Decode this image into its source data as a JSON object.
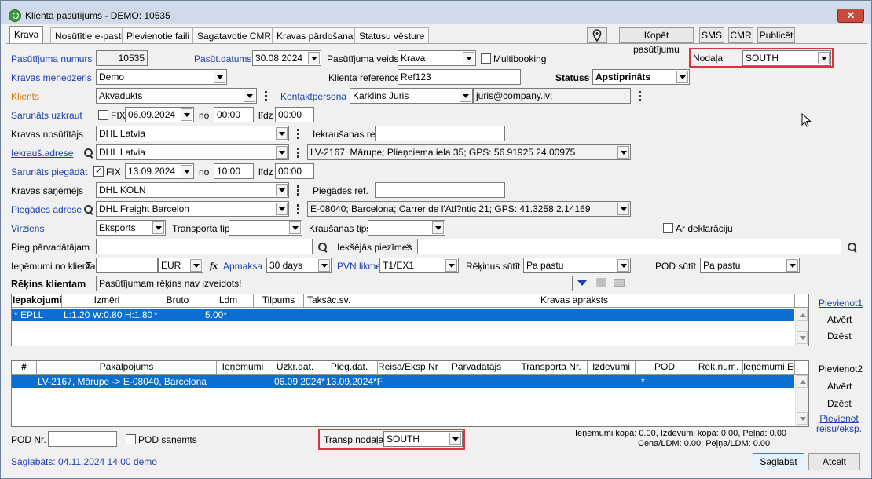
{
  "window": {
    "title": "Klienta pasūtījums - DEMO: 10535",
    "close": "✕"
  },
  "tabs": [
    {
      "label": "Krava"
    },
    {
      "label": "Nosūtītie e-pasti"
    },
    {
      "label": "Pievienotie faili"
    },
    {
      "label": "Sagatavotie CMR"
    },
    {
      "label": "Kravas pārdošana"
    },
    {
      "label": "Statusu vēsture"
    }
  ],
  "toolbar": {
    "copy": "Kopēt pasūtījumu",
    "sms": "SMS",
    "cmr": "CMR",
    "publish": "Publicēt"
  },
  "form": {
    "order_no_label": "Pasūtījuma numurs",
    "order_no": "10535",
    "order_date_label": "Pasūt.datums",
    "order_date": "30.08.2024",
    "order_type_label": "Pasūtījuma veids",
    "order_type": "Krava",
    "multibooking_label": "Multibooking",
    "department_label": "Nodaļa",
    "department": "SOUTH",
    "manager_label": "Kravas menedžeris",
    "manager": "Demo",
    "client_ref_label": "Klienta reference",
    "client_ref": "Ref123",
    "status_label": "Statuss",
    "status": "Apstiprināts",
    "client_label": "Klients",
    "client": "Akvadukts",
    "contact_label": "Kontaktpersona",
    "contact": "Karklins Juris",
    "contact_email": "juris@company.lv;",
    "load_agreed_label": "Sarunāts uzkraut",
    "fix_label": "FIX",
    "load_date": "06.09.2024",
    "from_label": "no",
    "to_label": "līdz",
    "load_from": "00:00",
    "load_to": "00:00",
    "sender_label": "Kravas nosūtītājs",
    "sender": "DHL Latvia",
    "load_ref_label": "Iekraušanas ref.",
    "load_ref": "",
    "load_addr_label": "Iekrauš.adrese",
    "load_addr_company": "DHL Latvia",
    "load_addr": "LV-2167; Mārupe; Plieņciema iela 35; GPS: 56.91925 24.00975",
    "delivery_agreed_label": "Sarunāts piegādāt",
    "delivery_fix_checked": "✓",
    "delivery_date": "13.09.2024",
    "delivery_from": "10:00",
    "delivery_to": "00:00",
    "receiver_label": "Kravas saņēmējs",
    "receiver": "DHL KOLN",
    "delivery_ref_label": "Piegādes ref.",
    "delivery_ref": "",
    "delivery_addr_label": "Piegādes adrese",
    "delivery_addr_company": "DHL Freight Barcelon",
    "delivery_addr": "E-08040; Barcelona; Carrer de l'Atl?ntic 21; GPS: 41.3258 2.14169",
    "direction_label": "Virziens",
    "direction": "Eksports",
    "transport_type_label": "Transporta tips",
    "transport_type": "",
    "loading_type_label": "Kraušanas tips",
    "loading_type": "",
    "declaration_label": "Ar deklarāciju",
    "carrier_label": "Pieg.pārvadātājam",
    "carrier": "",
    "internal_notes_label": "Iekšējās piezīmes",
    "internal_notes": "",
    "revenue_label": "Ieņēmumi no klienta",
    "revenue_sigma": "Σ",
    "revenue": "",
    "currency": "EUR",
    "fx_label": "fx",
    "payment_label": "Apmaksa",
    "payment": "30 days",
    "vat_label": "PVN likme",
    "vat": "T1/EX1",
    "invoice_send_label": "Rēķinus sūtīt",
    "invoice_send": "Pa pastu",
    "pod_send_label": "POD sūtīt",
    "pod_send": "Pa pastu",
    "invoice_client_label": "Rēķins klientam",
    "invoice_client": "Pasūtījumam rēķins nav izveidots!"
  },
  "packages": {
    "columns": [
      "Iepakojumi",
      "Izmēri",
      "Bruto",
      "Ldm",
      "Tilpums",
      "Taksāc.sv.",
      "Kravas apraksts"
    ],
    "rows": [
      {
        "pack": "* EPLL",
        "size": "L:1.20 W:0.80 H:1.80",
        "bruto": "*",
        "ldm": "5.00*",
        "vol": "",
        "tax": "",
        "desc": ""
      }
    ],
    "actions": {
      "add": "Pievienot1",
      "open": "Atvērt",
      "delete": "Dzēst"
    }
  },
  "services": {
    "columns": [
      "#",
      "Pakalpojums",
      "Ieņēmumi",
      "Uzkr.dat.",
      "Pieg.dat.",
      "Reisa/Eksp.Nr",
      "Pārvadātājs",
      "Transporta Nr.",
      "Izdevumi",
      "POD",
      "Rēķ.num.",
      "Ieņēmumi Eur"
    ],
    "rows": [
      {
        "num": "",
        "service": "LV-2167, Mārupe -> E-08040, Barcelona",
        "rev": "",
        "load": "06.09.2024*",
        "deliv": "13.09.2024*F",
        "trip": "",
        "carrier": "",
        "transport": "",
        "cost": "",
        "pod": "*",
        "inv": "",
        "reveur": ""
      }
    ],
    "actions": {
      "add": "Pievienot2",
      "open": "Atvērt",
      "delete": "Dzēst",
      "add_trip": "Pievienot reisu/eksp."
    }
  },
  "footer": {
    "pod_no_label": "POD Nr.",
    "pod_no": "",
    "pod_received_label": "POD saņemts",
    "transp_dept_label": "Transp.nodaļa",
    "transp_dept": "SOUTH",
    "totals_line1": "Ieņēmumi kopā: 0.00, Izdevumi kopā: 0.00, Peļņa: 0.00",
    "totals_line2": "Cena/LDM: 0.00; Peļņa/LDM: 0.00",
    "saved": "Saglabāts: 04.11.2024 14:00 demo",
    "save": "Saglabāt",
    "cancel": "Atcelt"
  },
  "colors": {
    "selection": "#0a6fd1",
    "link": "#1a3eb0",
    "highlight": "#d9363e",
    "client_label": "#d47a00"
  }
}
